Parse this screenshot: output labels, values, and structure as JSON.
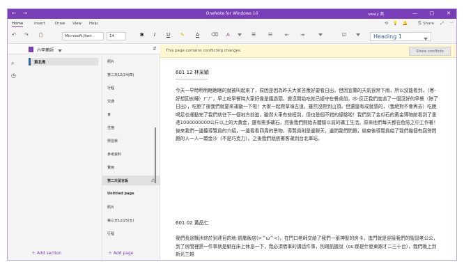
{
  "titlebar": {
    "title": "OneNote for Windows 10",
    "user": "swely 茜",
    "back_glyph": "←",
    "forward_glyph": "→",
    "minimize_glyph": "—",
    "maximize_glyph": "□",
    "close_glyph": "✕"
  },
  "menu": {
    "items": [
      "Home",
      "Insert",
      "Draw",
      "View",
      "Help"
    ],
    "share_label": "Share",
    "share_glyph": "⎘",
    "lightbulb_glyph": "💡",
    "bell_glyph": "🔔",
    "more_glyph": "···",
    "expand_glyph": "⤢"
  },
  "ribbon": {
    "undo_glyph": "↶",
    "redo_glyph": "↷",
    "clipboard_glyph": "📋",
    "font_name": "Microsoft Jhen",
    "font_size": "14",
    "bold": "B",
    "italic": "I",
    "underline": "U",
    "highlighter_glyph": "✎",
    "font_color_glyph": "A",
    "eraser_glyph": "⌫",
    "format_glyph": "A",
    "bullets_glyph": "☰",
    "numbering_glyph": "☷",
    "outdent_glyph": "⇤",
    "indent_glyph": "⇥",
    "checkbox_glyph": "☑",
    "heading_value": "Heading 1"
  },
  "notebook": {
    "name": "六甲藥師",
    "sort_glyph": "⇵"
  },
  "left_rail": {
    "notebooks_glyph": "▥",
    "search_glyph": "⌕",
    "recent_glyph": "◷"
  },
  "sections": {
    "items": [
      {
        "label": "東北角"
      }
    ],
    "add_label": "Add section"
  },
  "pages": {
    "items": [
      {
        "label": "照片"
      },
      {
        "label": "第二天12/24(四)"
      },
      {
        "label": "行程"
      },
      {
        "label": "交通"
      },
      {
        "label": "食"
      },
      {
        "label": "住宿"
      },
      {
        "label": "學習單"
      },
      {
        "label": "參考資料"
      },
      {
        "label": "費用"
      },
      {
        "label": "第二天留言板",
        "warning": "⚠"
      },
      {
        "label": "Untitled page"
      },
      {
        "label": "照片"
      },
      {
        "label": "第三天12/25(五)"
      },
      {
        "label": "行程"
      }
    ],
    "add_label": "Add page"
  },
  "conflict": {
    "message": "This page contains conflicting changes.",
    "button": "Show conflicts"
  },
  "canvas": {
    "heading1": "601  12       林采穎",
    "paragraph1": "今天一早時明明睏睏睏的就被叫起來了，原因是因為昨天大家答應好要看日出，但因宜蘭的天氣很常下雨，所以沒能看到，（寒-好想回去睡）ㄏㄏ，早上吃早餐時大家好像是餓過頭，變沒開始吃就已經守在餐桌前，吵-反正我們度過了一個沒好的早餐（除了日出），吃飽了後我們就要來運動一下啦！大家一起爬草嶺古道，雖然沒爬到山頂，但還蠻有成就感的，（我絕對不會再去）吃飽喝足也運動完了我們就往下一個地方前進，雖然火車有些程到，但也是個不錯的經驗啦！我們到了金瓜石的黃金博物館看到了重達1000000000公斤以上的大黃金，還有需多礦石，然後我們開始去體驗以前的礦工生活，原來他們每天都在危險之中工作著！後來我們一邊聽導覽員的介紹，一邊看看四周的景物，導覽員則是邊聊天，邊問我們問題，結束後導覽員給了我們幾個有回答問題的人一人一顆金沙（不是巧克力）。之後我們就搭著客運到台北車站。",
    "heading2": "601 02 黃品仁",
    "paragraph2": "我們長途飄涉終於到達目的地:凱撒飯店(>^ω^<)，在門口老師交給了我們一張神聖的房卡，進門就是迎接我們的聖誕老公公，到了房間裡第一件事就是躺在床上休息一下，我必須借車的講話件事，別跟凱撒說（os:那是什麼東跟才二三十台），我們晚上到新光三越"
  }
}
